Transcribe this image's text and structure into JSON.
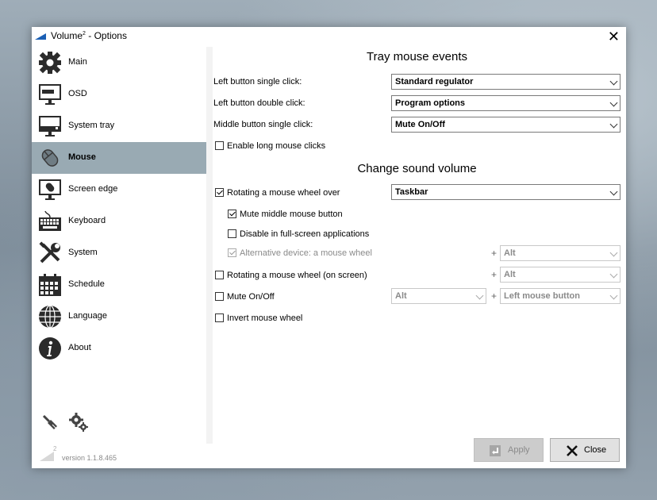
{
  "window": {
    "title_main": "Volume",
    "title_sup": "2",
    "title_rest": " - Options",
    "close_glyph": "✕"
  },
  "sidebar": {
    "items": [
      {
        "label": "Main",
        "icon": "gear-icon"
      },
      {
        "label": "OSD",
        "icon": "monitor-icon"
      },
      {
        "label": "System tray",
        "icon": "monitor-tray-icon"
      },
      {
        "label": "Mouse",
        "icon": "mouse-icon",
        "active": true
      },
      {
        "label": "Screen edge",
        "icon": "monitor-mouse-icon"
      },
      {
        "label": "Keyboard",
        "icon": "keyboard-icon"
      },
      {
        "label": "System",
        "icon": "tools-icon"
      },
      {
        "label": "Schedule",
        "icon": "calendar-icon"
      },
      {
        "label": "Language",
        "icon": "globe-icon"
      },
      {
        "label": "About",
        "icon": "info-icon"
      }
    ],
    "active_color": "#99aab3"
  },
  "tray": {
    "title": "Tray mouse events",
    "left_single_label": "Left button single click:",
    "left_single_value": "Standard regulator",
    "left_double_label": "Left button double click:",
    "left_double_value": "Program options",
    "middle_single_label": "Middle button single click:",
    "middle_single_value": "Mute On/Off",
    "long_clicks_label": "Enable long mouse clicks"
  },
  "sound": {
    "title": "Change sound volume",
    "wheel_over_label": "Rotating a mouse wheel over",
    "wheel_over_value": "Taskbar",
    "mute_middle_label": "Mute middle mouse button",
    "disable_fullscreen_label": "Disable in full-screen applications",
    "alt_device_label": "Alternative device: a mouse wheel",
    "alt_device_mod": "Alt",
    "wheel_screen_label": "Rotating a mouse wheel (on screen)",
    "wheel_screen_mod": "Alt",
    "mute_label": "Mute On/Off",
    "mute_mod": "Alt",
    "mute_button": "Left mouse button",
    "invert_label": "Invert mouse wheel",
    "plus": "+"
  },
  "footer": {
    "version": "version 1.1.8.465",
    "logo_sup": "2",
    "apply": "Apply",
    "close": "Close"
  }
}
